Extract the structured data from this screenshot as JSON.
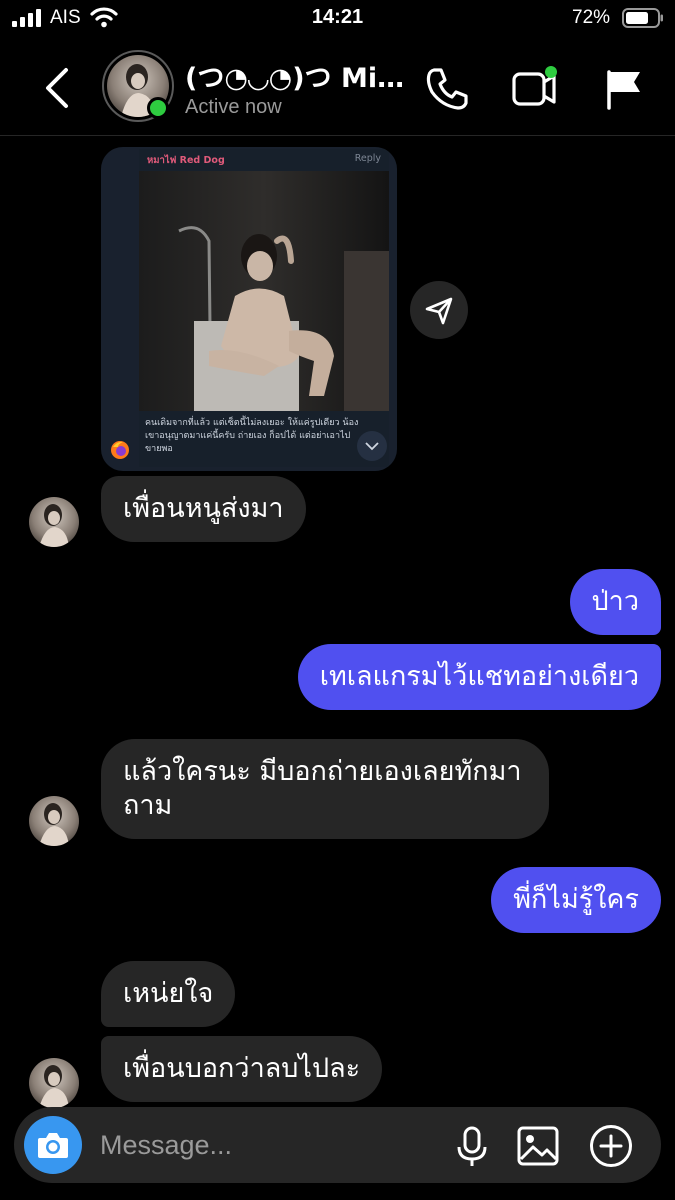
{
  "status_bar": {
    "carrier": "AIS",
    "time": "14:21",
    "battery": "72%"
  },
  "header": {
    "name": "(つ◔◡◔)つ Mis...",
    "status": "Active now"
  },
  "shared_post": {
    "sender": "หมาไฟ Red Dog",
    "reply": "Reply",
    "caption": "คนเดิมจากที่แล้ว แต่เซ็ตนี้ไม่ลงเยอะ ให้แค่รูปเดียว น้องเขาอนุญาตมาแค่นี้ครับ ถ่ายเอง ก็อปได้ แต่อย่าเอาไปขายพอ"
  },
  "messages": [
    {
      "from": "them",
      "text": "เพื่อนหนูส่งมา"
    },
    {
      "from": "me",
      "text": "ป่าว"
    },
    {
      "from": "me",
      "text": "เทเลแกรมไว้แชทอย่างเดียว"
    },
    {
      "from": "them",
      "text": "แล้วใครนะ มีบอกถ่ายเองเลยทักมา"
    },
    {
      "from": "them",
      "text": "ถาม"
    },
    {
      "from": "me",
      "text": "พี่ก็ไม่รู้ใคร"
    },
    {
      "from": "them",
      "text": "เหน่ยใจ"
    },
    {
      "from": "them",
      "text": "เพื่อนบอกว่าลบไปละ"
    }
  ],
  "composer": {
    "placeholder": "Message..."
  },
  "icons": {
    "back": "chevron-left-icon",
    "call": "phone-icon",
    "video": "video-camera-icon",
    "flag": "flag-icon",
    "share": "send-icon",
    "camera": "camera-icon",
    "mic": "microphone-icon",
    "gallery": "image-icon",
    "plus": "plus-circle-icon"
  },
  "colors": {
    "sent_bubble": "#5050f0",
    "received_bubble": "#262626",
    "online": "#2ecc40",
    "camera_button": "#3897f0"
  }
}
